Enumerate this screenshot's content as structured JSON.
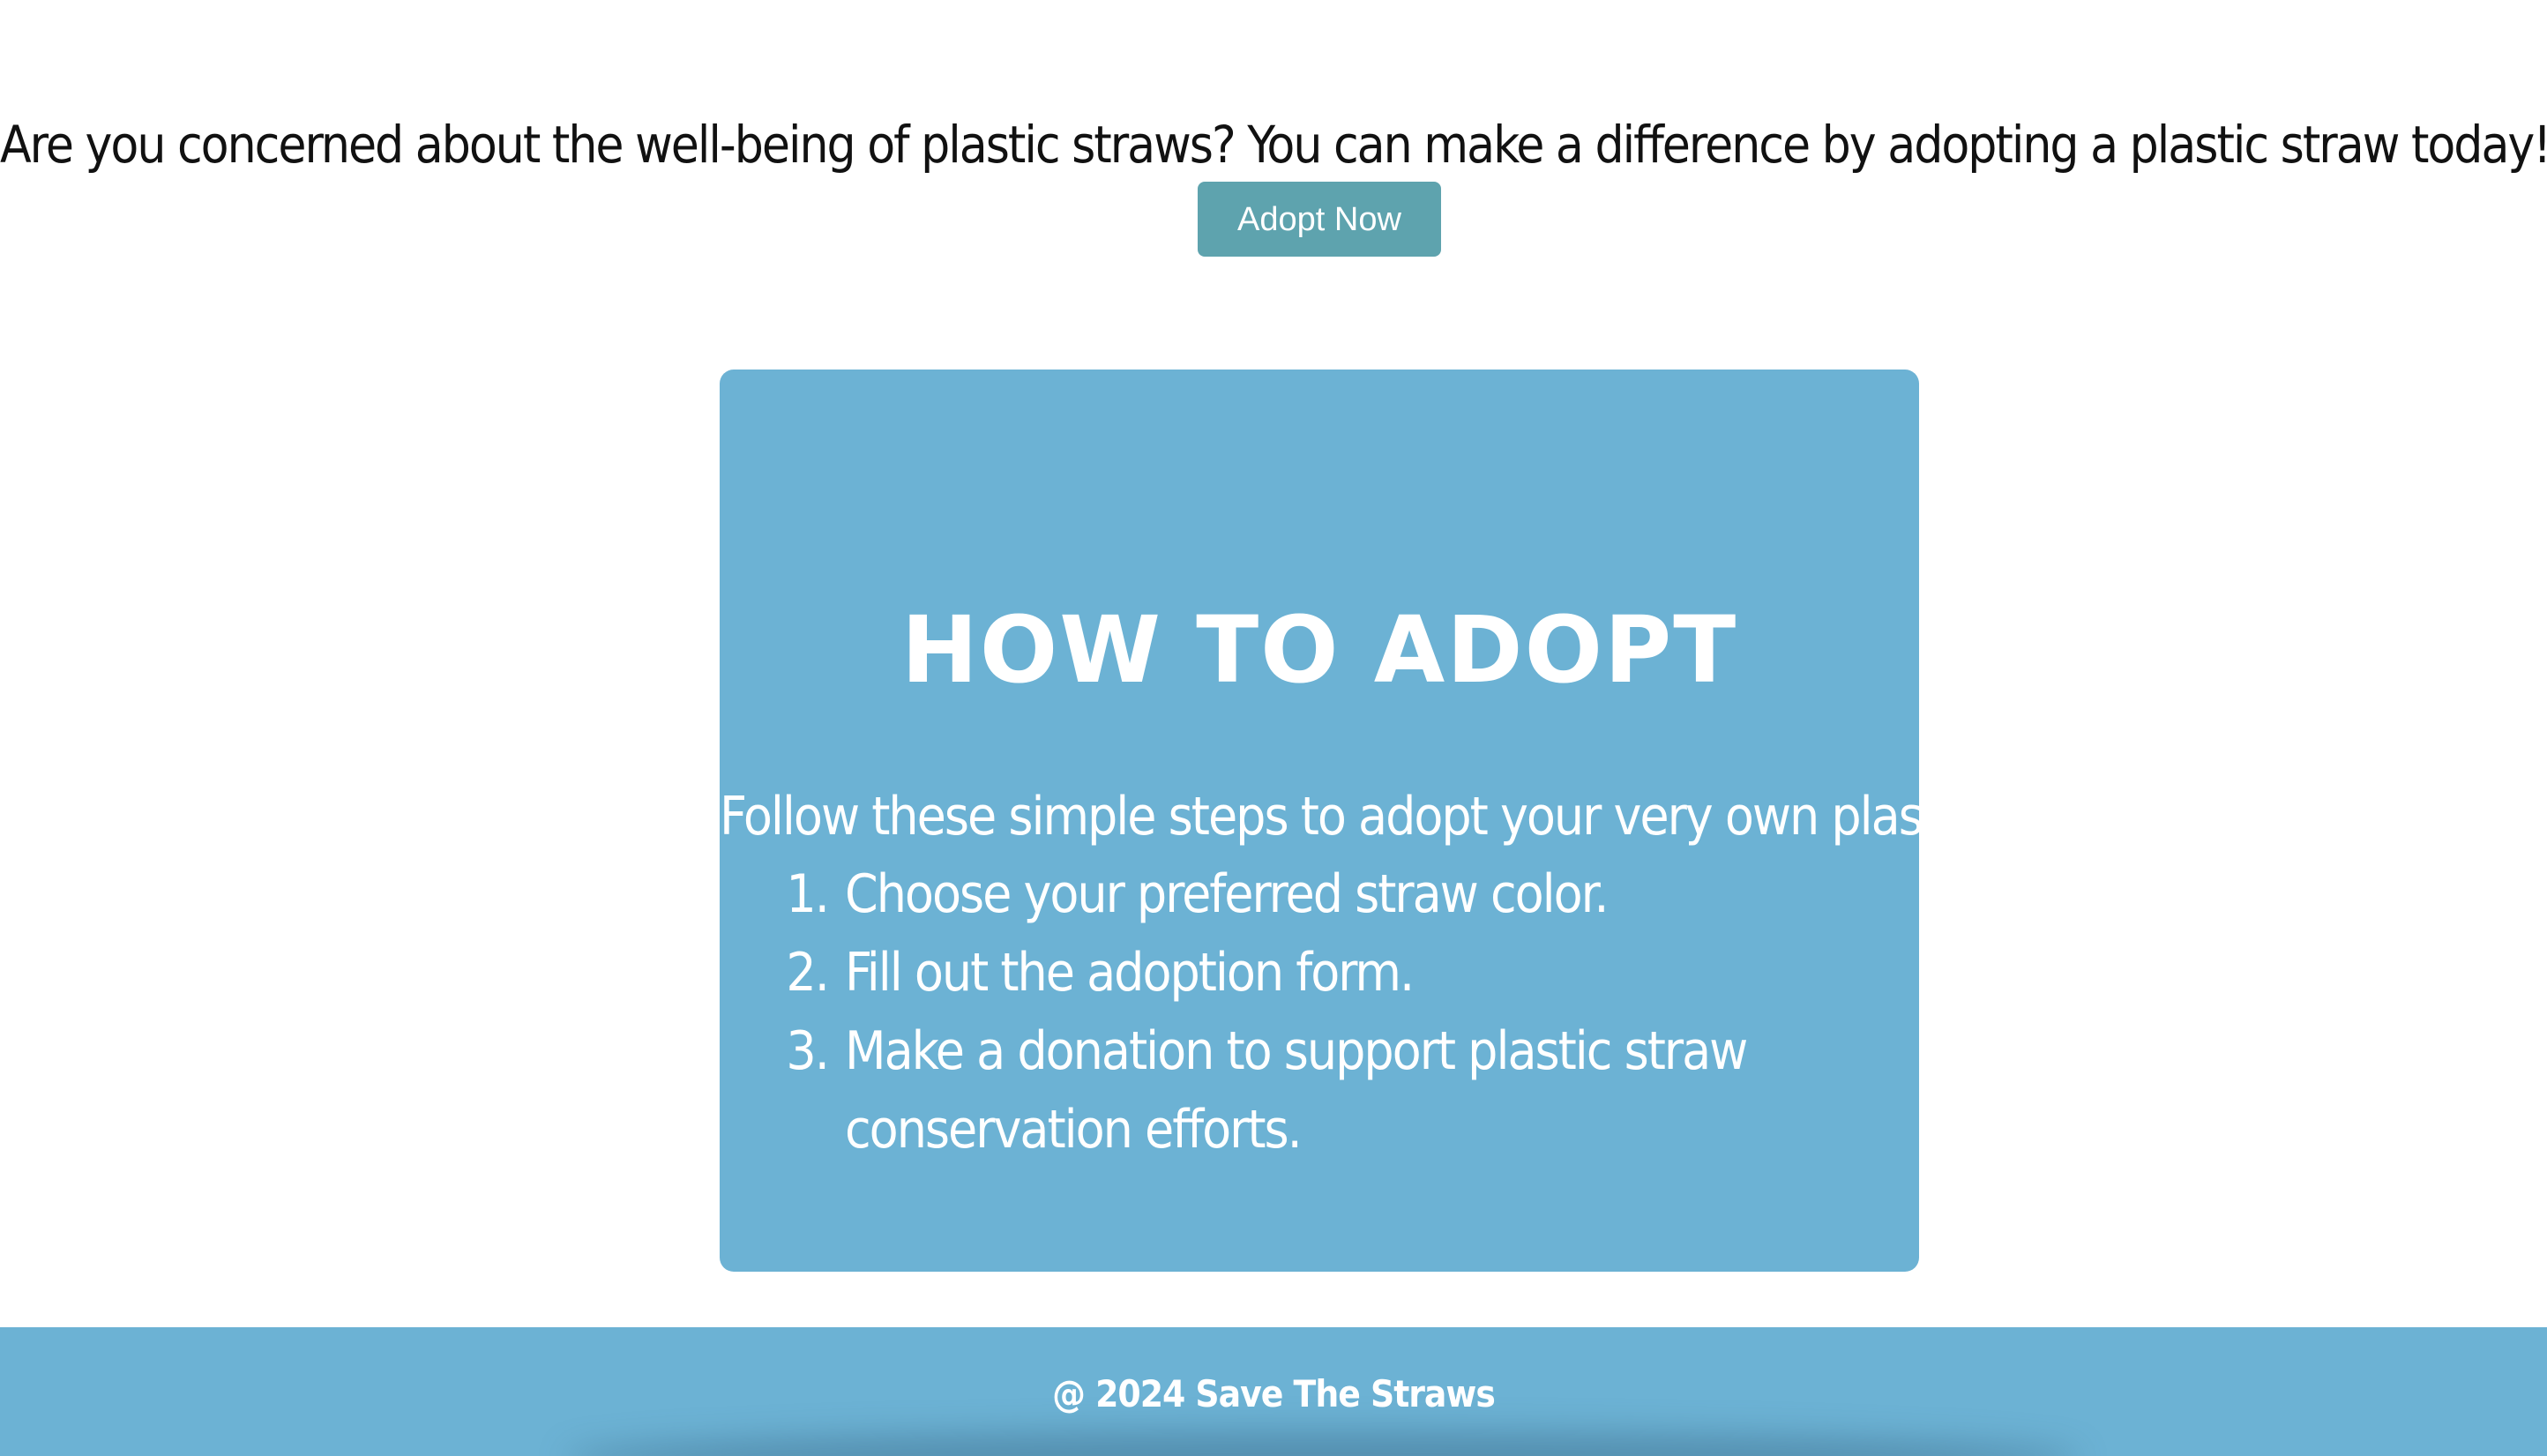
{
  "intro": {
    "text": "Are you concerned about the well-being of plastic straws? You can make a difference by adopting a plastic straw today!"
  },
  "adopt_button": {
    "label": "Adopt Now"
  },
  "how_to_adopt": {
    "title": "HOW TO ADOPT",
    "subtitle": "Follow these simple steps to adopt your very own plastic straw:",
    "steps": [
      "Choose your preferred straw color.",
      "Fill out the adoption form.",
      "Make a donation to support plastic straw conservation efforts."
    ]
  },
  "footer": {
    "text": "@ 2024 Save The Straws"
  },
  "colors": {
    "button_bg": "#5ea3ae",
    "card_bg": "#6cb2d4",
    "footer_bg": "#6cb2d4",
    "text_dark": "#111111",
    "text_light": "#ffffff"
  }
}
